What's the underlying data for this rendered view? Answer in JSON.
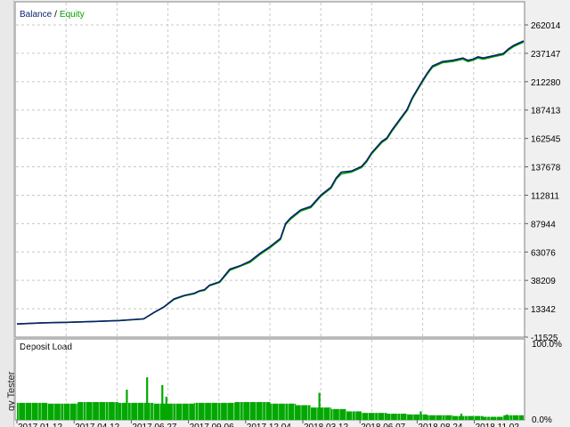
{
  "side_tab": {
    "label": "gy Tester"
  },
  "colors": {
    "balance": "#0d1f6e",
    "equity": "#00a000",
    "deposit_load": "#00a800",
    "grid": "#c8c8c8",
    "background": "#ffffff"
  },
  "chart_data": [
    {
      "type": "line",
      "title": "",
      "legend": {
        "placement": "top-left",
        "items": [
          "Balance",
          "Equity"
        ],
        "separator": "/"
      },
      "ylim": [
        -11525,
        262014
      ],
      "y_ticks": [
        262014,
        237147,
        212280,
        187413,
        162545,
        137678,
        112811,
        87944,
        63076,
        38209,
        13342,
        -11525
      ],
      "grid": true,
      "x_range": [
        0,
        100
      ],
      "series": [
        {
          "name": "Balance",
          "x": [
            0,
            5,
            10,
            15,
            20,
            25,
            27,
            29,
            31,
            33,
            35,
            36,
            37,
            38,
            40,
            42,
            44,
            46,
            48,
            50,
            52,
            53,
            54,
            56,
            58,
            60,
            62,
            63,
            64,
            66,
            68,
            69,
            70,
            72,
            73,
            74,
            76,
            77,
            78,
            80,
            81,
            82,
            84,
            86,
            87,
            88,
            89,
            90,
            91,
            92,
            94,
            96,
            97,
            98,
            99,
            100
          ],
          "values": [
            0,
            1000,
            1500,
            2200,
            3000,
            4500,
            10000,
            15000,
            22000,
            25000,
            27000,
            29000,
            30000,
            34000,
            37000,
            48000,
            51000,
            55000,
            62000,
            68000,
            75000,
            88000,
            93000,
            100000,
            103000,
            113000,
            120000,
            128000,
            133000,
            134000,
            138000,
            143000,
            150000,
            160000,
            163000,
            170000,
            182000,
            188000,
            198000,
            213000,
            220000,
            226000,
            230000,
            231000,
            232000,
            233000,
            231000,
            232000,
            234000,
            233000,
            235000,
            237000,
            241000,
            244000,
            246000,
            248000
          ]
        },
        {
          "name": "Equity",
          "x": [
            0,
            5,
            10,
            15,
            20,
            25,
            27,
            29,
            31,
            33,
            35,
            36,
            37,
            38,
            40,
            42,
            44,
            46,
            48,
            50,
            52,
            53,
            54,
            56,
            58,
            60,
            62,
            63,
            64,
            66,
            68,
            69,
            70,
            72,
            73,
            74,
            76,
            77,
            78,
            80,
            81,
            82,
            84,
            86,
            87,
            88,
            89,
            90,
            91,
            92,
            94,
            96,
            97,
            98,
            99,
            100
          ],
          "values": [
            0,
            1000,
            1500,
            2200,
            3000,
            4400,
            9800,
            14700,
            21500,
            24600,
            26500,
            28600,
            29500,
            33500,
            36500,
            47000,
            50500,
            54000,
            61000,
            67000,
            74000,
            87000,
            92000,
            99000,
            102000,
            112000,
            119000,
            127000,
            131500,
            133000,
            137000,
            142000,
            149000,
            159000,
            162000,
            169000,
            181000,
            187000,
            197000,
            212000,
            219000,
            225000,
            229000,
            230000,
            231000,
            232000,
            230000,
            231000,
            233000,
            232000,
            234000,
            236000,
            240000,
            243000,
            245000,
            247000
          ]
        }
      ]
    },
    {
      "type": "bar",
      "title": "Deposit Load",
      "ylim": [
        0,
        100
      ],
      "y_ticks": [
        "100.0%",
        "0.0%"
      ],
      "x_ticks": [
        "2017.01.12",
        "2017.04.12",
        "2017.06.27",
        "2017.09.06",
        "2017.12.04",
        "2018.03.12",
        "2018.06.07",
        "2018.08.24",
        "2018.11.02"
      ],
      "series": [
        {
          "name": "Deposit Load",
          "segments": [
            {
              "from": 0,
              "to": 6,
              "value": 22
            },
            {
              "from": 6,
              "to": 12,
              "value": 21
            },
            {
              "from": 12,
              "to": 20,
              "value": 23
            },
            {
              "from": 20,
              "to": 27,
              "value": 22
            },
            {
              "from": 27,
              "to": 35,
              "value": 21
            },
            {
              "from": 35,
              "to": 43,
              "value": 22
            },
            {
              "from": 43,
              "to": 50,
              "value": 23
            },
            {
              "from": 50,
              "to": 55,
              "value": 21
            },
            {
              "from": 55,
              "to": 58,
              "value": 19
            },
            {
              "from": 58,
              "to": 62,
              "value": 16
            },
            {
              "from": 62,
              "to": 65,
              "value": 14
            },
            {
              "from": 65,
              "to": 68,
              "value": 11
            },
            {
              "from": 68,
              "to": 73,
              "value": 9
            },
            {
              "from": 73,
              "to": 77,
              "value": 8
            },
            {
              "from": 77,
              "to": 81,
              "value": 7
            },
            {
              "from": 81,
              "to": 86,
              "value": 6
            },
            {
              "from": 86,
              "to": 92,
              "value": 5
            },
            {
              "from": 92,
              "to": 96,
              "value": 4
            },
            {
              "from": 96,
              "to": 100,
              "value": 6
            }
          ],
          "spikes": [
            {
              "x": 21.5,
              "value": 39
            },
            {
              "x": 25.5,
              "value": 55
            },
            {
              "x": 28.5,
              "value": 45
            },
            {
              "x": 29.3,
              "value": 30
            },
            {
              "x": 59.5,
              "value": 35
            },
            {
              "x": 79.5,
              "value": 11
            },
            {
              "x": 87.5,
              "value": 8
            },
            {
              "x": 96.5,
              "value": 7
            }
          ]
        }
      ]
    }
  ]
}
